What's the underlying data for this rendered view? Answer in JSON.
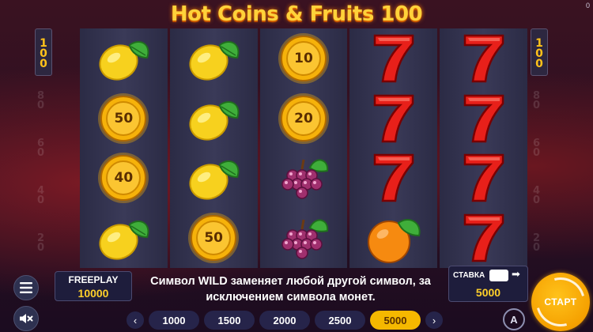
{
  "title": "Hot Coins & Fruits 100",
  "corner_counter": "0",
  "lines": {
    "active": "100",
    "inactive": [
      "80",
      "60",
      "40",
      "20"
    ]
  },
  "reels": [
    [
      {
        "symbol": "lemon"
      },
      {
        "symbol": "coin",
        "value": "50"
      },
      {
        "symbol": "coin",
        "value": "40"
      },
      {
        "symbol": "lemon"
      }
    ],
    [
      {
        "symbol": "lemon"
      },
      {
        "symbol": "lemon"
      },
      {
        "symbol": "lemon"
      },
      {
        "symbol": "coin",
        "value": "50"
      }
    ],
    [
      {
        "symbol": "coin",
        "value": "10"
      },
      {
        "symbol": "coin",
        "value": "20"
      },
      {
        "symbol": "grapes"
      },
      {
        "symbol": "grapes"
      }
    ],
    [
      {
        "symbol": "seven"
      },
      {
        "symbol": "seven"
      },
      {
        "symbol": "seven"
      },
      {
        "symbol": "orange"
      }
    ],
    [
      {
        "symbol": "seven"
      },
      {
        "symbol": "seven"
      },
      {
        "symbol": "seven"
      },
      {
        "symbol": "seven"
      }
    ]
  ],
  "freeplay": {
    "label": "FREEPLAY",
    "value": "10000"
  },
  "message": "Символ WILD заменяет любой другой символ, за исключением символа монет.",
  "stake": {
    "label": "СТАВКА",
    "arrow": "➡",
    "value": "5000"
  },
  "bets": {
    "options": [
      "1000",
      "1500",
      "2000",
      "2500",
      "5000"
    ],
    "selected": "5000",
    "prev": "‹",
    "next": "›"
  },
  "auto_label": "A",
  "start_label": "СТАРТ",
  "icons": {
    "menu": "menu-icon",
    "sound": "sound-off-icon"
  },
  "colors": {
    "gold": "#ffd02a",
    "reel": "#2b2b45",
    "selected_bet": "#f5b800"
  }
}
